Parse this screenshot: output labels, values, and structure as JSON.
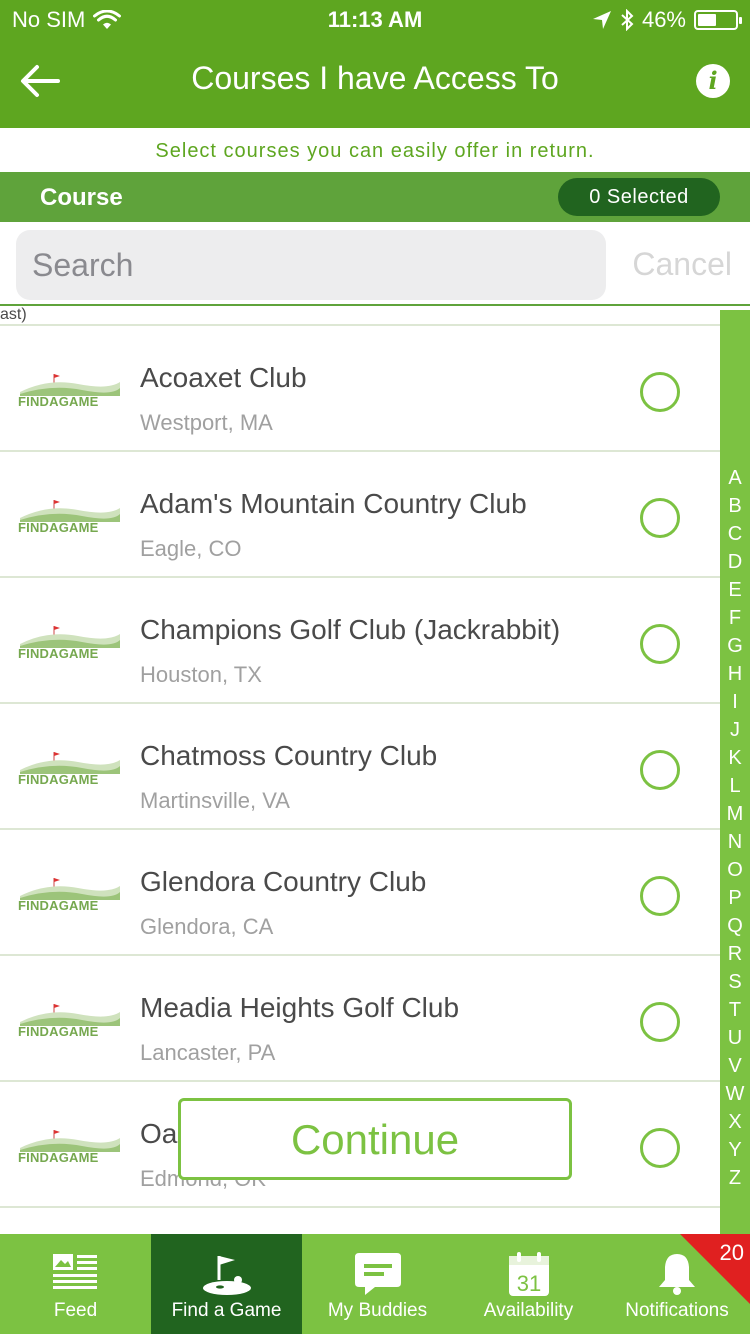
{
  "status_bar": {
    "carrier": "No SIM",
    "time": "11:13 AM",
    "battery": "46%",
    "battery_level": 0.46
  },
  "nav": {
    "title": "Courses I have Access To",
    "info_glyph": "i"
  },
  "subtitle": "Select courses you can easily offer in return.",
  "section": {
    "label": "Course",
    "selected": "0 Selected"
  },
  "search": {
    "placeholder": "Search",
    "cancel": "Cancel"
  },
  "logo_text": "FINDAGAME",
  "courses": [
    {
      "name": "Acoaxet Club",
      "location": "Westport, MA",
      "selected": false
    },
    {
      "name": "Adam's Mountain Country Club",
      "location": "Eagle, CO",
      "selected": false
    },
    {
      "name": "Champions Golf Club (Jackrabbit)",
      "location": "Houston, TX",
      "selected": false
    },
    {
      "name": "Chatmoss Country Club",
      "location": "Martinsville, VA",
      "selected": false
    },
    {
      "name": "Glendora Country Club",
      "location": "Glendora, CA",
      "selected": false
    },
    {
      "name": "Meadia Heights Golf Club",
      "location": "Lancaster, PA",
      "selected": false
    },
    {
      "name": "Oa",
      "name_tail": "ast)",
      "location": "Edmond, OK",
      "selected": false
    }
  ],
  "index_letters": [
    "A",
    "B",
    "C",
    "D",
    "E",
    "F",
    "G",
    "H",
    "I",
    "J",
    "K",
    "L",
    "M",
    "N",
    "O",
    "P",
    "Q",
    "R",
    "S",
    "T",
    "U",
    "V",
    "W",
    "X",
    "Y",
    "Z"
  ],
  "continue_label": "Continue",
  "tabs": [
    {
      "label": "Feed",
      "icon": "newspaper-icon",
      "active": false
    },
    {
      "label": "Find a Game",
      "icon": "golf-flag-icon",
      "active": true
    },
    {
      "label": "My Buddies",
      "icon": "chat-bubble-icon",
      "active": false
    },
    {
      "label": "Availability",
      "icon": "calendar-icon",
      "calendar_day": "31",
      "active": false
    },
    {
      "label": "Notifications",
      "icon": "bell-icon",
      "badge": "20",
      "active": false
    }
  ],
  "colors": {
    "brand_green": "#5ea620",
    "accent_green": "#7cc242",
    "dark_green": "#21641f",
    "badge_red": "#e02020"
  }
}
